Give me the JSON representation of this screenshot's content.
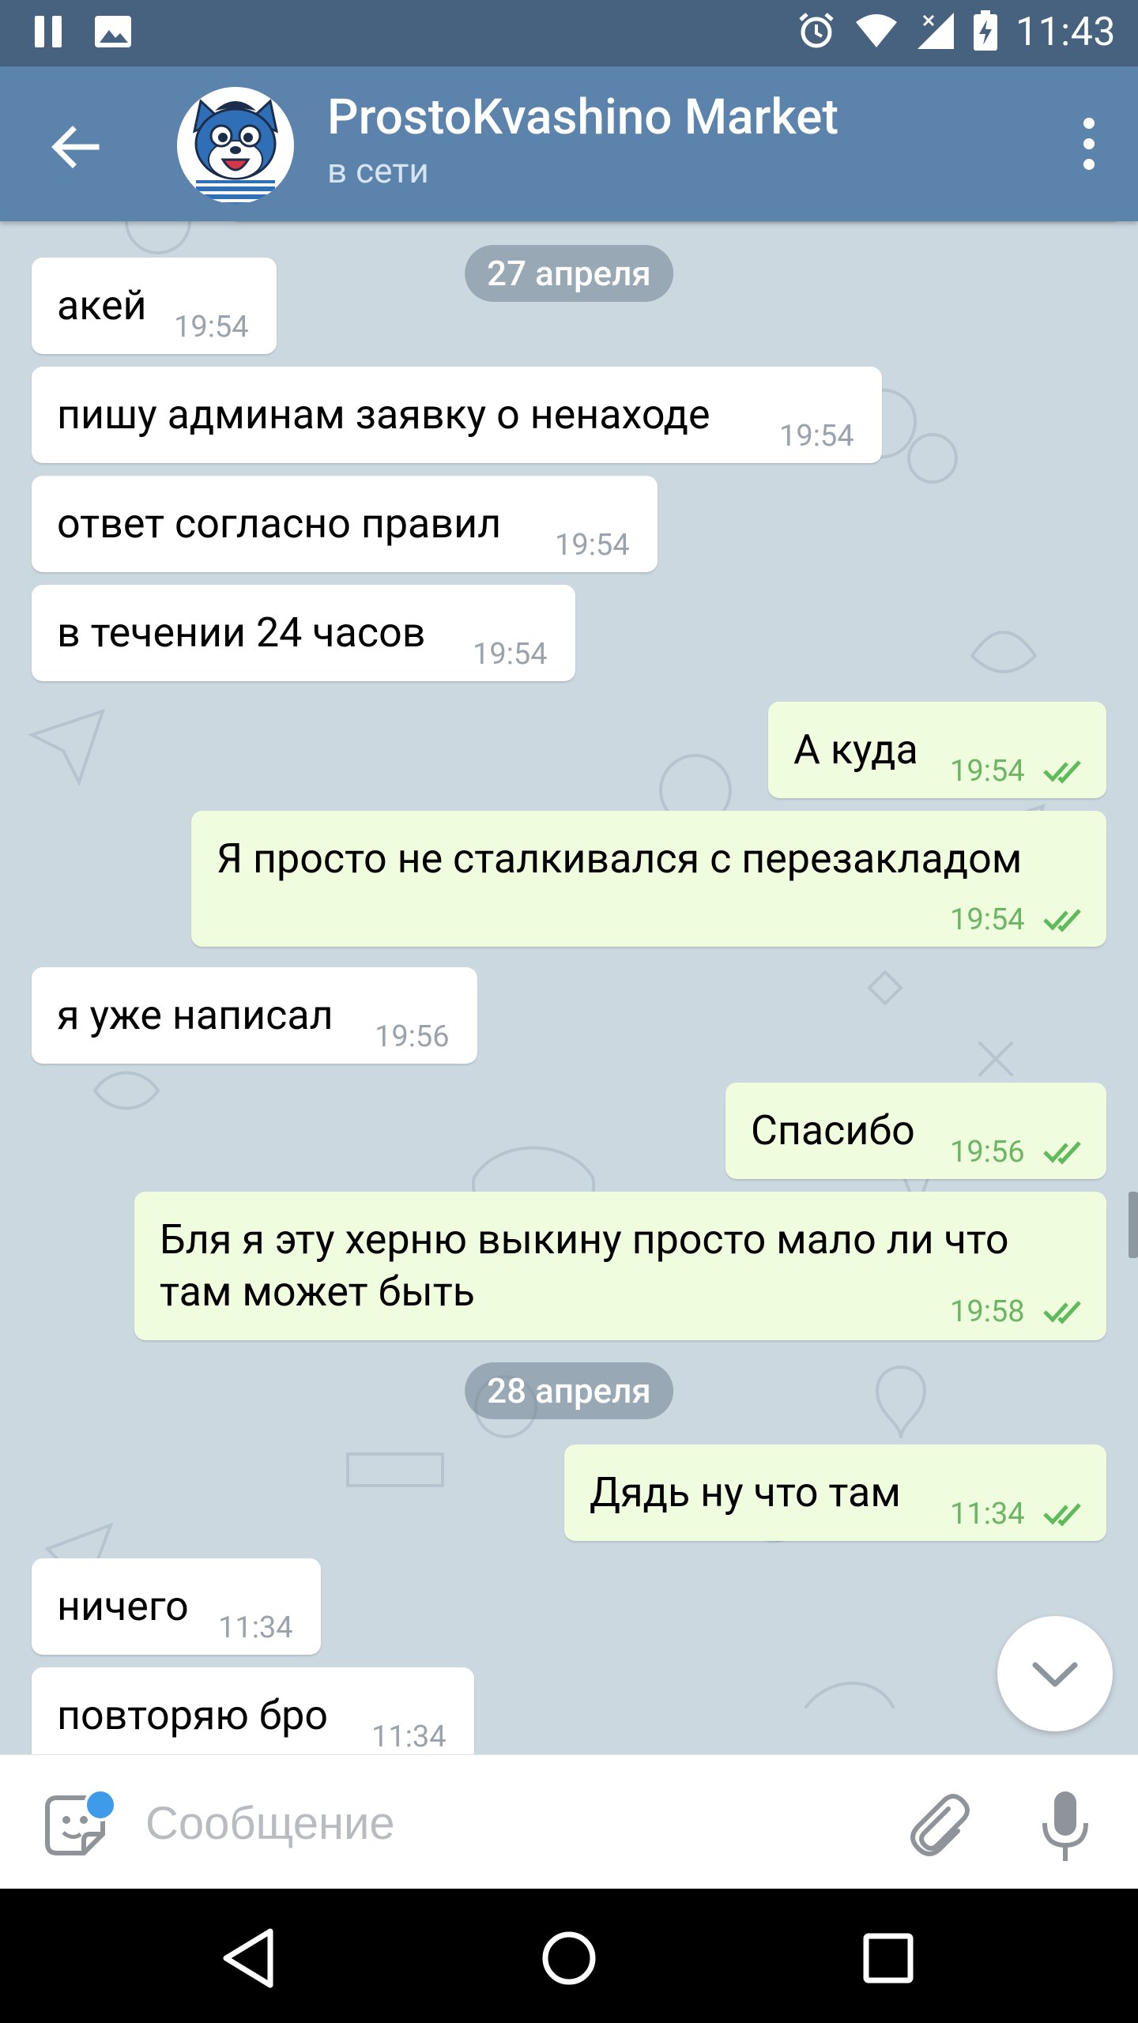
{
  "status_bar": {
    "time": "11:43",
    "icons": [
      "pause-icon",
      "image-icon",
      "alarm-icon",
      "wifi-icon",
      "signal-icon",
      "battery-charging-icon"
    ]
  },
  "toolbar": {
    "title": "ProstoKvashino Market",
    "status": "в сети",
    "back_icon": "arrow-back-icon",
    "menu_icon": "more-vert-icon"
  },
  "messages": [
    {
      "dir": "date",
      "text": "27 апреля"
    },
    {
      "dir": "in",
      "text": "акей",
      "time": "19:54"
    },
    {
      "dir": "in",
      "text": "пишу админам заявку о ненаходе",
      "time": "19:54"
    },
    {
      "dir": "in",
      "text": "ответ согласно правил",
      "time": "19:54"
    },
    {
      "dir": "in",
      "text": "в течении 24 часов",
      "time": "19:54"
    },
    {
      "dir": "out",
      "text": "А куда",
      "time": "19:54",
      "status": "read"
    },
    {
      "dir": "out",
      "text": "Я просто не сталкивался с перезакладом",
      "time": "19:54",
      "status": "read"
    },
    {
      "dir": "in",
      "text": "я уже написал",
      "time": "19:56"
    },
    {
      "dir": "out",
      "text": "Спасибо",
      "time": "19:56",
      "status": "read"
    },
    {
      "dir": "out",
      "text_line1": "Бля я эту херню выкину просто мало ли что",
      "text_line2": "там может быть",
      "time": "19:58",
      "status": "read"
    },
    {
      "dir": "date",
      "text": "28 апреля"
    },
    {
      "dir": "out",
      "text": "Дядь ну что там",
      "time": "11:34",
      "status": "read"
    },
    {
      "dir": "in",
      "text": "ничего",
      "time": "11:34"
    },
    {
      "dir": "in",
      "text": "повторяю бро",
      "time": "11:34"
    }
  ],
  "input": {
    "placeholder": "Сообщение",
    "value": ""
  },
  "colors": {
    "status_bar": "#47627f",
    "toolbar": "#5b83ab",
    "incoming_bubble": "#ffffff",
    "outgoing_bubble": "#effdde",
    "read_ticks": "#5fba5c",
    "badge_dot": "#3e9bea"
  }
}
